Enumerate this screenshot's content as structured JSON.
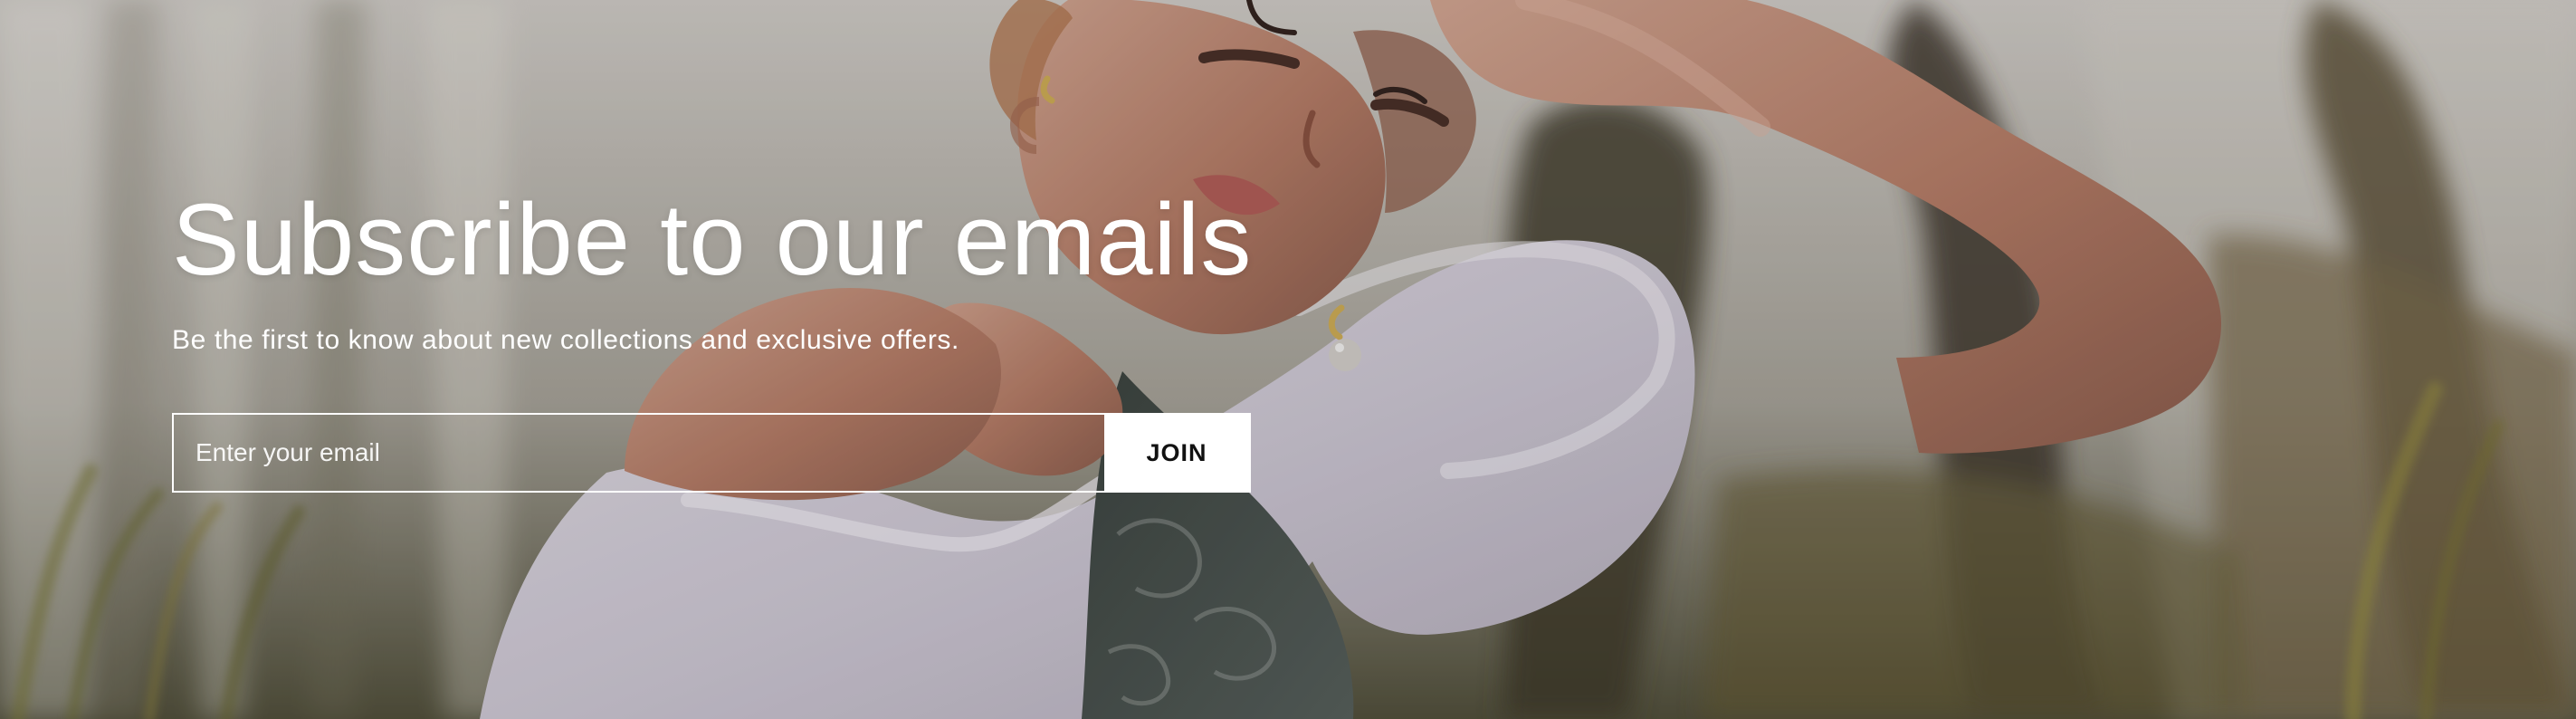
{
  "newsletter": {
    "title": "Subscribe to our emails",
    "subtitle": "Be the first to know about new collections and exclusive offers.",
    "email_placeholder": "Enter your email",
    "join_label": "JOIN"
  },
  "icons": {
    "hero_image": "woman-in-field-image"
  },
  "colors": {
    "text": "#ffffff",
    "button_background": "#ffffff",
    "button_text": "#111111"
  }
}
